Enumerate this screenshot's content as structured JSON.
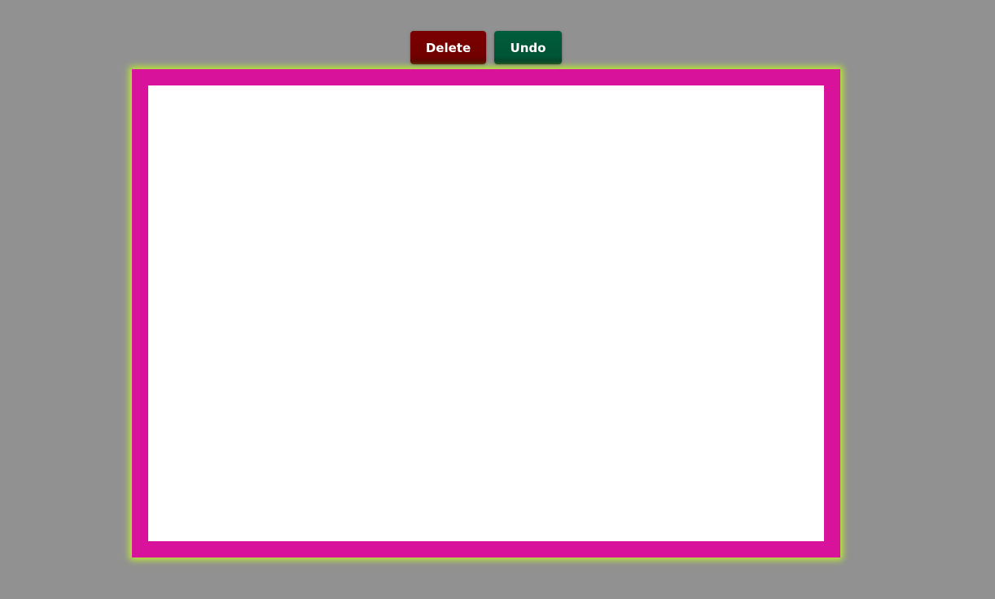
{
  "toolbar": {
    "delete_label": "Delete",
    "undo_label": "Undo"
  },
  "colors": {
    "background": "#919191",
    "frame_border": "#d9129b",
    "frame_glow": "#c6ff20",
    "canvas": "#ffffff",
    "delete_button": "#720000",
    "undo_button": "#005536"
  }
}
